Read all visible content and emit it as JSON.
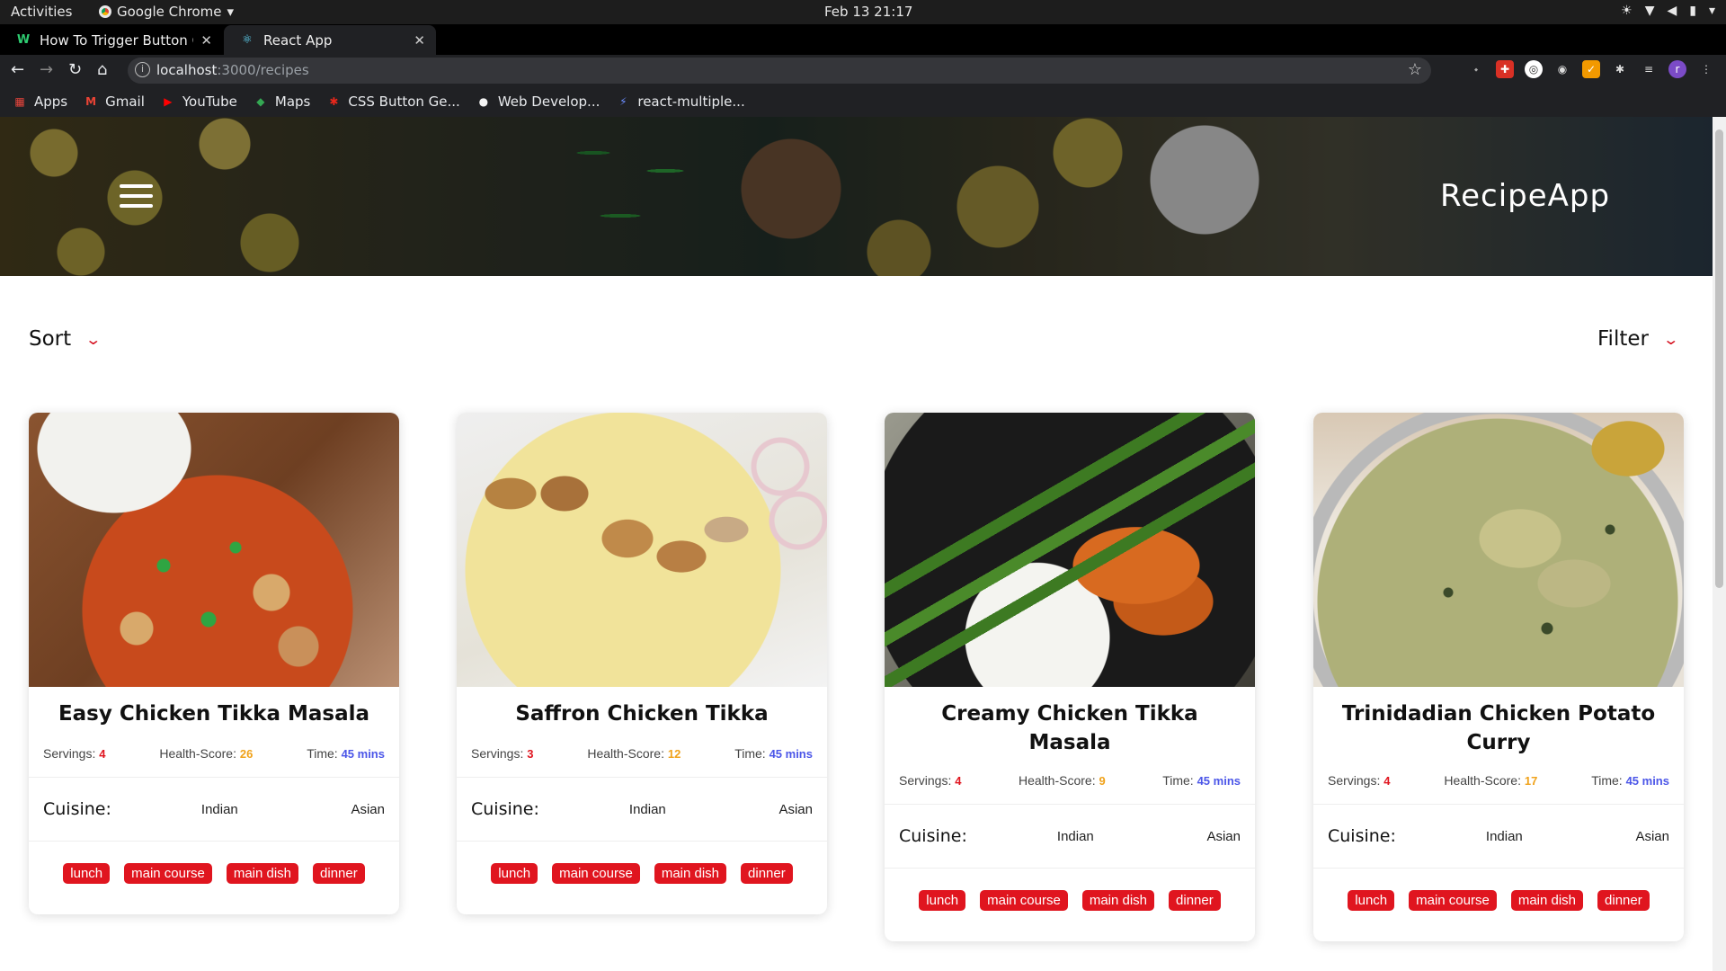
{
  "os_bar": {
    "activities": "Activities",
    "app_menu": "Google Chrome",
    "clock": "Feb 13  21:17"
  },
  "tabs": [
    {
      "title": "How To Trigger Button Cl",
      "favicon": "w-icon"
    },
    {
      "title": "React App",
      "favicon": "react-icon"
    }
  ],
  "address_bar": {
    "host": "localhost",
    "path": ":3000/recipes"
  },
  "bookmarks": [
    {
      "label": "Apps",
      "icon": "apps-grid-icon"
    },
    {
      "label": "Gmail",
      "icon": "gmail-icon"
    },
    {
      "label": "YouTube",
      "icon": "youtube-icon"
    },
    {
      "label": "Maps",
      "icon": "maps-icon"
    },
    {
      "label": "CSS Button Ge...",
      "icon": "star-icon"
    },
    {
      "label": "Web Develop...",
      "icon": "circle-icon"
    },
    {
      "label": "react-multiple...",
      "icon": "lightning-icon"
    }
  ],
  "header": {
    "brand": "RecipeApp"
  },
  "controls": {
    "sort_label": "Sort",
    "filter_label": "Filter"
  },
  "stat_labels": {
    "servings": "Servings:",
    "health": "Health-Score:",
    "time": "Time:",
    "cuisine": "Cuisine:"
  },
  "colors": {
    "accent_red": "#e0151f",
    "health_orange": "#f0a21a",
    "time_blue": "#4b56e8"
  },
  "recipes": [
    {
      "name": "Easy Chicken Tikka Masala",
      "servings": "4",
      "health_score": "26",
      "time": "45 mins",
      "cuisines": [
        "Indian",
        "Asian"
      ],
      "tags": [
        "lunch",
        "main course",
        "main dish",
        "dinner"
      ]
    },
    {
      "name": "Saffron Chicken Tikka",
      "servings": "3",
      "health_score": "12",
      "time": "45 mins",
      "cuisines": [
        "Indian",
        "Asian"
      ],
      "tags": [
        "lunch",
        "main course",
        "main dish",
        "dinner"
      ]
    },
    {
      "name": "Creamy Chicken Tikka Masala",
      "servings": "4",
      "health_score": "9",
      "time": "45 mins",
      "cuisines": [
        "Indian",
        "Asian"
      ],
      "tags": [
        "lunch",
        "main course",
        "main dish",
        "dinner"
      ]
    },
    {
      "name": "Trinidadian Chicken Potato Curry",
      "servings": "4",
      "health_score": "17",
      "time": "45 mins",
      "cuisines": [
        "Indian",
        "Asian"
      ],
      "tags": [
        "lunch",
        "main course",
        "main dish",
        "dinner"
      ]
    }
  ]
}
